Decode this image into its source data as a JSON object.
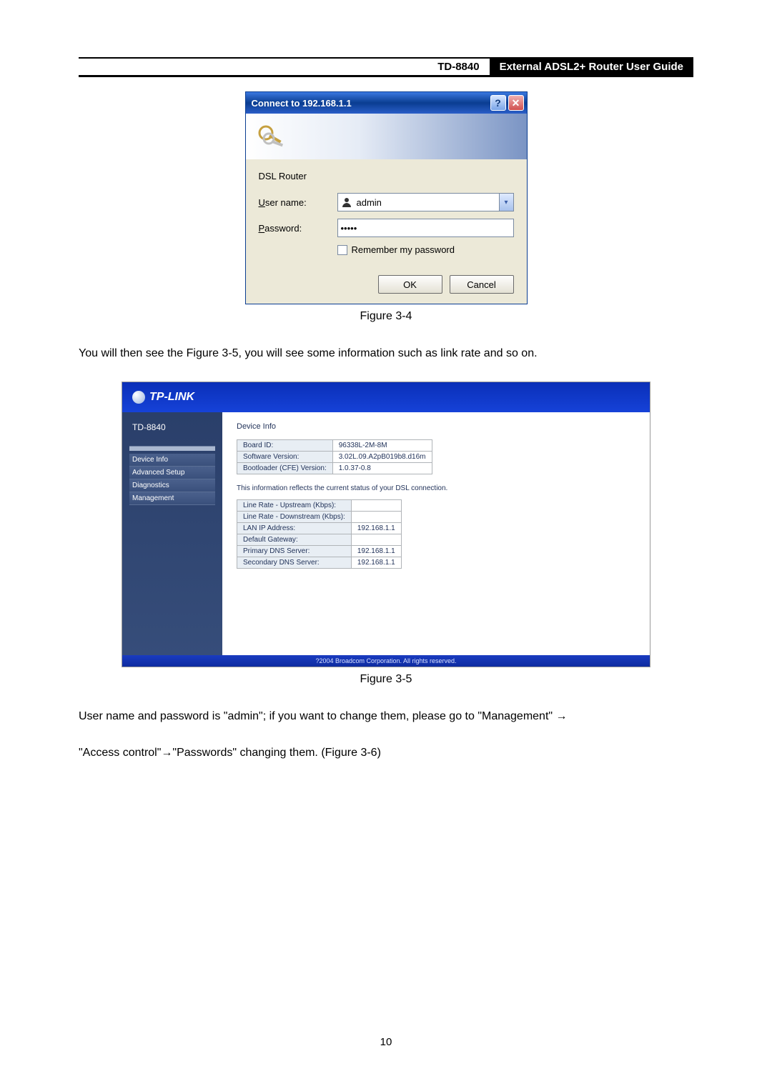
{
  "header": {
    "model": "TD-8840",
    "title": "External  ADSL2+  Router  User  Guide"
  },
  "auth_dialog": {
    "title": "Connect to 192.168.1.1",
    "help_symbol": "?",
    "close_symbol": "✕",
    "section_label": "DSL Router",
    "username_label_prefix": "U",
    "username_label_rest": "ser name:",
    "username_value": "admin",
    "password_label_prefix": "P",
    "password_label_rest": "assword:",
    "password_value": "•••••",
    "remember_prefix": "R",
    "remember_rest": "emember my password",
    "ok_label": "OK",
    "cancel_label": "Cancel",
    "dropdown_symbol": "▾"
  },
  "caption1": "Figure 3-4",
  "para1": "You will then see the Figure 3-5, you will see some information such as link rate and so on.",
  "tp": {
    "brand": "TP-LINK",
    "model": "TD-8840",
    "nav": {
      "item1": "Device Info",
      "item2": "Advanced Setup",
      "item3": "Diagnostics",
      "item4": "Management"
    },
    "content_heading": "Device Info",
    "sys_table": {
      "r1k": "Board ID:",
      "r1v": "96338L-2M-8M",
      "r2k": "Software Version:",
      "r2v": "3.02L.09.A2pB019b8.d16m",
      "r3k": "Bootloader (CFE) Version:",
      "r3v": "1.0.37-0.8"
    },
    "note": "This information reflects the current status of your DSL connection.",
    "conn_table": {
      "r1k": "Line Rate - Upstream (Kbps):",
      "r1v": "",
      "r2k": "Line Rate - Downstream (Kbps):",
      "r2v": "",
      "r3k": "LAN IP Address:",
      "r3v": "192.168.1.1",
      "r4k": "Default Gateway:",
      "r4v": "",
      "r5k": "Primary DNS Server:",
      "r5v": "192.168.1.1",
      "r6k": "Secondary DNS Server:",
      "r6v": "192.168.1.1"
    },
    "footer": "?2004 Broadcom Corporation. All rights reserved."
  },
  "caption2": "Figure 3-5",
  "para2a": "User name and password is \"admin\"; if you want to change them, please go to \"Management\" ",
  "arrow": "→",
  "para3a": "\"Access control\"",
  "para3b": "\"Passwords\" changing them. (Figure 3-6)",
  "page_number": "10"
}
